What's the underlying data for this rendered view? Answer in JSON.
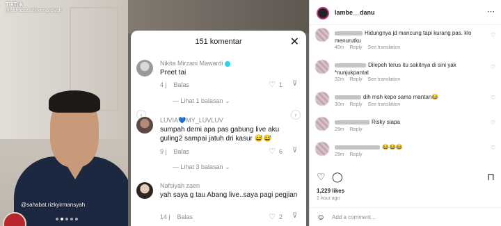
{
  "video": {
    "brand": "TikTok",
    "handle": "@sahabat.rizkyirmansyah",
    "caption": "@sahabat.rizkyirmansyah"
  },
  "comments_sheet": {
    "title": "151 komentar",
    "reply_label": "Balas",
    "comments": [
      {
        "name": "Nikita Mirzani Mawardi",
        "text": "Preet tai",
        "time": "4 j",
        "likes": "1",
        "replies": "Lihat 1 balasan"
      },
      {
        "name": "LUVIA💙MY_LUVLUV",
        "text": "sumpah demi apa pas gabung live aku guling2 sampai jatuh dri kasur 😅😅",
        "time": "9 j",
        "likes": "6",
        "replies": "Lihat 3 balasan"
      },
      {
        "name": "Nafsiyah zaen",
        "text": "yah saya g tau Abang live..saya pagi pegjian",
        "time": "14 j",
        "likes": "2"
      }
    ]
  },
  "instagram": {
    "username": "lambe__danu",
    "reply_label": "Reply",
    "see_translation": "See translation",
    "comments": [
      {
        "text": "Hidungnya jd mancung tapi kurang pas. klo menurutku",
        "time": "40m"
      },
      {
        "text": "Dilepeh terus itu sakitnya di sini yak *nunjukpantat",
        "time": "32m"
      },
      {
        "text": "dih msh kepo sama mantan😂",
        "time": "30m"
      },
      {
        "text": "Risky siapa",
        "time": "29m"
      },
      {
        "text": "😂😂😂",
        "time": "29m"
      }
    ],
    "likes": "1,229 likes",
    "posted": "1 hour ago",
    "add_comment_placeholder": "Add a comment..."
  }
}
